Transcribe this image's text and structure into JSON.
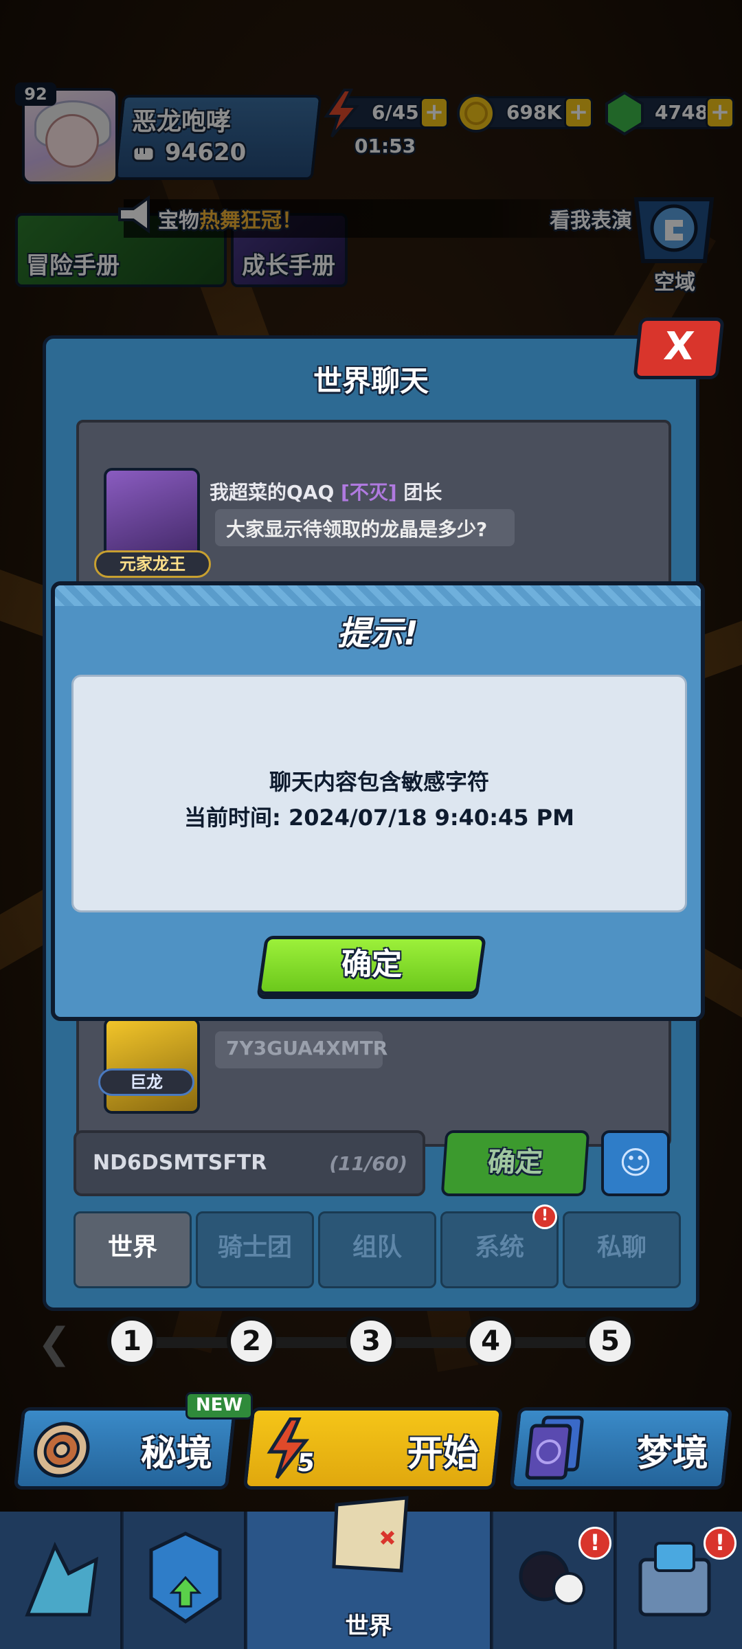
{
  "player": {
    "level": "92",
    "name": "恶龙咆哮",
    "power": "94620"
  },
  "resources": {
    "energy": "6/45",
    "energy_timer": "01:53",
    "gold": "698K",
    "gems": "4748"
  },
  "news": {
    "left": "宝物",
    "highlight": "热舞狂冠！",
    "right": "看我表演"
  },
  "shortcuts": {
    "adventure_manual": "冒险手册",
    "growth_manual": "成长手册",
    "space": "空域"
  },
  "chat": {
    "title": "世界聊天",
    "close": "X",
    "messages": [
      {
        "sender": "我超菜的QAQ",
        "guild": "[不灭]",
        "role": "团长",
        "title_tag": "元家龙王",
        "text": "大家显示待领取的龙晶是多少?"
      },
      {
        "sender": "",
        "guild": "",
        "role": "",
        "title_tag": "巨龙",
        "text": "7Y3GUA4XMTR"
      }
    ],
    "input": {
      "value": "ND6DSMTSFTR",
      "counter": "(11/60)"
    },
    "send_label": "确定",
    "emoji": "☺",
    "tabs": [
      {
        "label": "世界",
        "active": true
      },
      {
        "label": "骑士团",
        "active": false
      },
      {
        "label": "组队",
        "active": false
      },
      {
        "label": "系统",
        "active": false,
        "alert": "!"
      },
      {
        "label": "私聊",
        "active": false
      }
    ]
  },
  "stages": [
    "1",
    "2",
    "3",
    "4",
    "5"
  ],
  "stage_arrow": "❮",
  "modes": {
    "secret_realm": "秘境",
    "new_tag": "NEW",
    "start": "开始",
    "start_cost": "5",
    "dreamland": "梦境"
  },
  "nav": {
    "world_label": "世界",
    "alert": "!"
  },
  "dialog": {
    "title": "提示!",
    "line1": "聊天内容包含敏感字符",
    "line2": "当前时间: 2024/07/18 9:40:45 PM",
    "confirm": "确定"
  },
  "colors": {
    "panel_blue": "#2d6a93",
    "dialog_blue": "#4f92c4",
    "confirm_green": "#7ed321",
    "alert_red": "#d9352c",
    "gold_yellow": "#f5c518"
  }
}
